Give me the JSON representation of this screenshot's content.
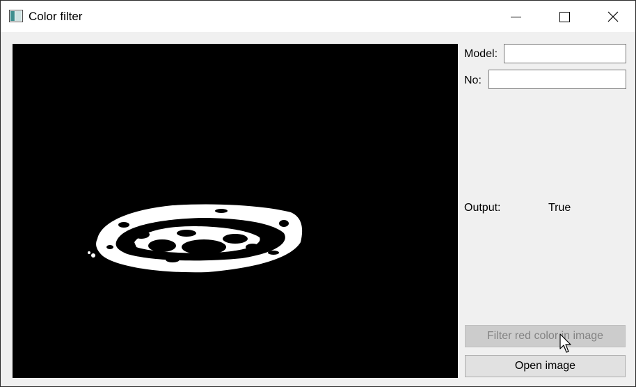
{
  "window": {
    "title": "Color filter"
  },
  "form": {
    "model_label": "Model:",
    "model_value": "",
    "no_label": "No:",
    "no_value": "",
    "output_label": "Output:",
    "output_value": "True"
  },
  "buttons": {
    "filter_label": "Filter red color in image",
    "filter_enabled": false,
    "open_label": "Open image"
  },
  "icons": {
    "app": "app-window-icon",
    "minimize": "minimize-icon",
    "maximize": "maximize-icon",
    "close": "close-icon",
    "cursor": "mouse-pointer-icon"
  },
  "image_view": {
    "content": "binary mask (white on black)"
  }
}
